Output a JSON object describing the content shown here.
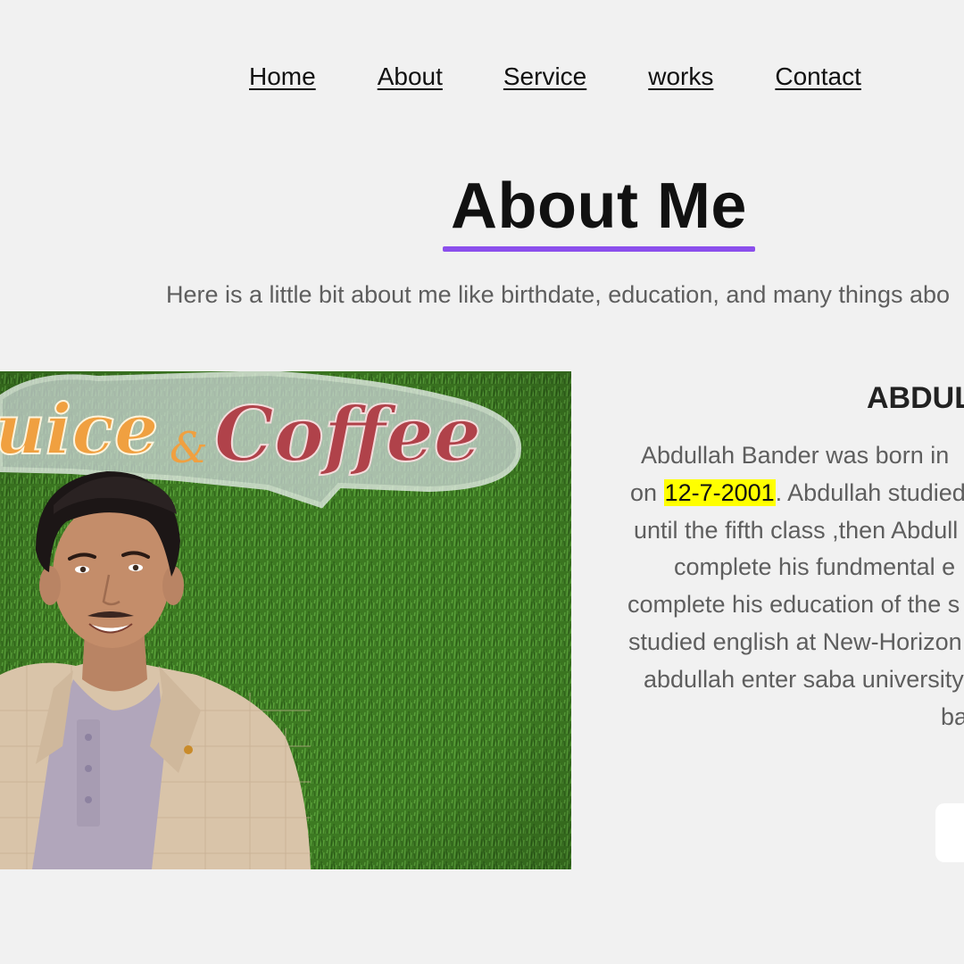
{
  "nav": {
    "items": [
      {
        "label": "Home"
      },
      {
        "label": "About"
      },
      {
        "label": "Service"
      },
      {
        "label": "works"
      },
      {
        "label": "Contact"
      }
    ]
  },
  "about": {
    "title": "About Me",
    "subtitle": "Here is a little bit about me like birthdate, education, and many things abo",
    "name": "ABDUL",
    "bio": {
      "line1": "Abdullah Bander was born in",
      "line2_prefix": "on ",
      "birthdate": "12-7-2001",
      "line2_suffix": ". Abdullah studied",
      "line3": "until the fifth class ,then Abdull",
      "line4": "complete his fundmental e",
      "line5": "complete his education of the s",
      "line6": "studied english at New-Horizon",
      "line7": "abdullah enter saba university",
      "line8": "ba"
    }
  },
  "photo": {
    "sign_text_left": "uice",
    "sign_text_amp": "&",
    "sign_text_right": "Coffee"
  },
  "colors": {
    "background": "#f1f1f1",
    "accent": "#8b4fec",
    "highlight": "#ffff00",
    "muted_text": "#5e5e5e"
  }
}
